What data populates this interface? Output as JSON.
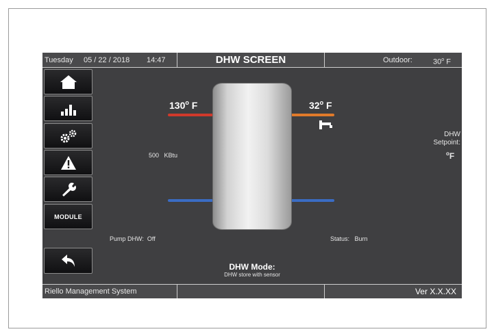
{
  "header": {
    "day": "Tuesday",
    "date": "05 / 22 / 2018",
    "time": "14:47",
    "title": "DHW SCREEN",
    "outdoor_label": "Outdoor:",
    "outdoor_value": "30",
    "outdoor_unit": "F"
  },
  "sidebar": {
    "items": [
      {
        "name": "home",
        "icon": "home-icon"
      },
      {
        "name": "statistics",
        "icon": "bar-chart-icon"
      },
      {
        "name": "settings",
        "icon": "gears-icon"
      },
      {
        "name": "alarms",
        "icon": "warning-icon"
      },
      {
        "name": "service",
        "icon": "wrench-icon"
      },
      {
        "name": "module",
        "label": "MODULE"
      },
      {
        "name": "back",
        "icon": "back-arrow-icon"
      }
    ]
  },
  "main": {
    "supply_temp": "130",
    "supply_unit": "F",
    "cold_temp": "32",
    "cold_unit": "F",
    "power_value": "500",
    "power_unit": "KBtu",
    "setpoint_label_1": "DHW",
    "setpoint_label_2": "Setpoint:",
    "setpoint_unit": "F",
    "pump_label": "Pump DHW:",
    "pump_value": "Off",
    "status_label": "Status:",
    "status_value": "Burn",
    "mode_label": "DHW Mode:",
    "mode_value": "DHW store with sensor"
  },
  "footer": {
    "system_name": "Riello Management System",
    "version": "Ver X.X.XX"
  },
  "colors": {
    "hot_pipe": "#d0392b",
    "warm_pipe": "#e07a2a",
    "cold_pipe": "#3a6cc4",
    "screen_bg": "#3f3f41"
  }
}
